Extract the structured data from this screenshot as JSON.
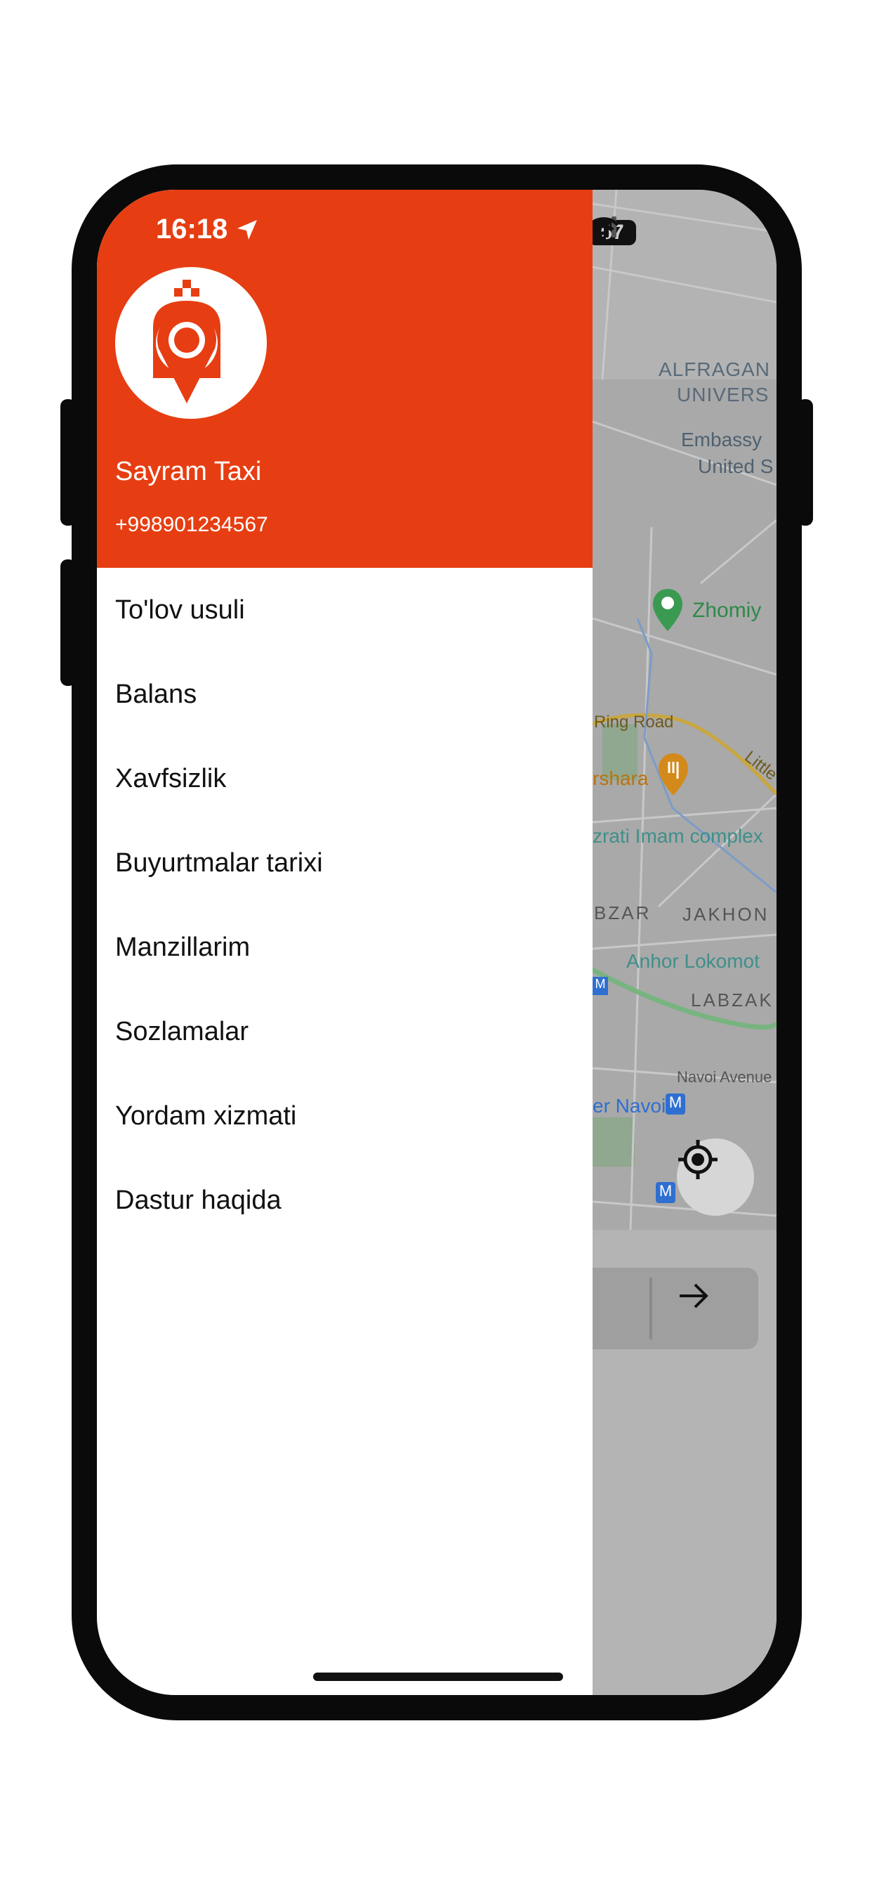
{
  "status_bar": {
    "time": "16:18",
    "battery": "67"
  },
  "drawer": {
    "user_name": "Sayram Taxi",
    "user_phone": "+998901234567",
    "menu": [
      {
        "label": "To'lov usuli"
      },
      {
        "label": "Balans"
      },
      {
        "label": "Xavfsizlik"
      },
      {
        "label": "Buyurtmalar tarixi"
      },
      {
        "label": "Manzillarim"
      },
      {
        "label": "Sozlamalar"
      },
      {
        "label": "Yordam xizmati"
      },
      {
        "label": "Dastur haqida"
      }
    ]
  },
  "map": {
    "labels": {
      "alfragan": "ALFRAGAN",
      "univers": "UNIVERS",
      "embassy": "Embassy",
      "united": "United S",
      "zhomiy": "Zhomiy",
      "ring_road": "Ring Road",
      "little": "Little",
      "shara": "rshara",
      "imam": "zrati Imam complex",
      "bzar": "BZAR",
      "jakhon": "JAKHON",
      "anhor": "Anhor Lokomot",
      "labzak": "LABZAK",
      "navoi_ave": "Navoi Avenue",
      "navoi": "er Navoi"
    }
  },
  "colors": {
    "brand": "#e63e12",
    "map_bg": "#b3b3b3"
  }
}
